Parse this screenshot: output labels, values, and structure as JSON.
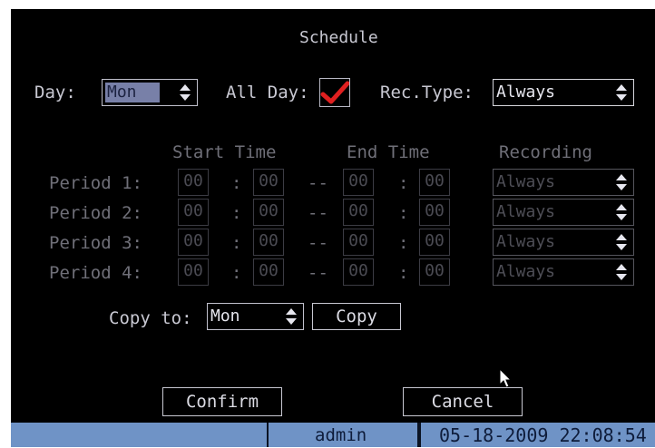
{
  "dialog": {
    "title": "Schedule",
    "day_label": "Day:",
    "day_value": "Mon",
    "all_day_label": "All Day:",
    "all_day_checked": true,
    "rec_type_label": "Rec.Type:",
    "rec_type_value": "Always"
  },
  "table": {
    "headers": {
      "start": "Start Time",
      "end": "End Time",
      "recording": "Recording"
    },
    "colon": ":",
    "separator": "--",
    "periods": [
      {
        "label": "Period 1:",
        "start_h": "00",
        "start_m": "00",
        "end_h": "00",
        "end_m": "00",
        "recording": "Always"
      },
      {
        "label": "Period 2:",
        "start_h": "00",
        "start_m": "00",
        "end_h": "00",
        "end_m": "00",
        "recording": "Always"
      },
      {
        "label": "Period 3:",
        "start_h": "00",
        "start_m": "00",
        "end_h": "00",
        "end_m": "00",
        "recording": "Always"
      },
      {
        "label": "Period 4:",
        "start_h": "00",
        "start_m": "00",
        "end_h": "00",
        "end_m": "00",
        "recording": "Always"
      }
    ]
  },
  "copy": {
    "label": "Copy to:",
    "value": "Mon",
    "button": "Copy"
  },
  "buttons": {
    "confirm": "Confirm",
    "cancel": "Cancel"
  },
  "status_bar": {
    "user": "admin",
    "datetime": "05-18-2009 22:08:54"
  },
  "colors": {
    "background": "#000000",
    "status_bar": "#6f93c6",
    "check": "#e02020",
    "day_select": "#7880a8"
  },
  "icons": {
    "checkbox": "checkmark-icon",
    "select": "up-down-arrow-icon",
    "cursor": "mouse-pointer-icon"
  }
}
